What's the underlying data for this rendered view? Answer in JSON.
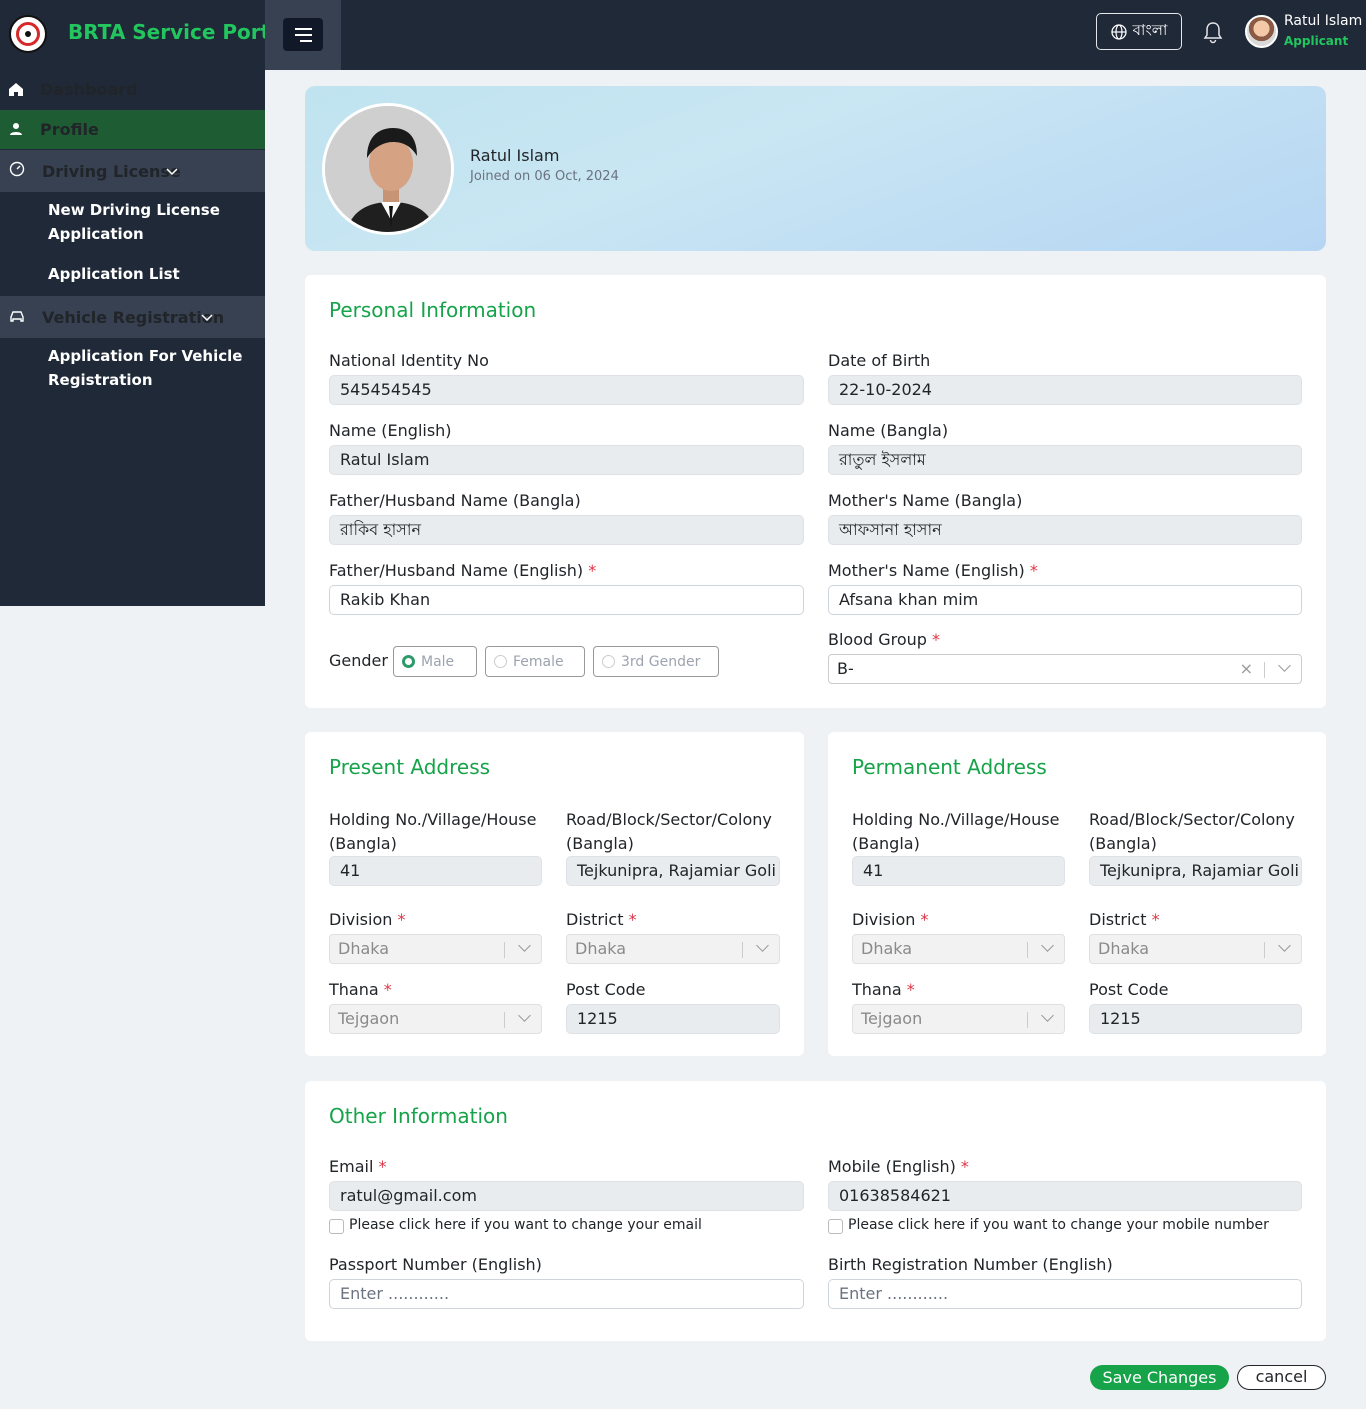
{
  "brand": {
    "title": "BRTA Service Portal"
  },
  "topbar": {
    "language_label": "বাংলা",
    "user_name": "Ratul Islam",
    "user_role": "Applicant"
  },
  "sidebar": {
    "dashboard": "Dashboard",
    "profile": "Profile",
    "driving_license": "Driving License",
    "new_driving_license": "New Driving License Application",
    "application_list": "Application List",
    "vehicle_registration": "Vehicle Registration",
    "vehicle_application": "Application For Vehicle Registration"
  },
  "profile": {
    "name": "Ratul Islam",
    "joined": "Joined on 06 Oct, 2024"
  },
  "personal": {
    "title": "Personal Information",
    "nid_label": "National Identity No",
    "nid": "545454545",
    "dob_label": "Date of Birth",
    "dob": "22-10-2024",
    "name_en_label": "Name (English)",
    "name_en": "Ratul Islam",
    "name_bn_label": "Name (Bangla)",
    "name_bn": "রাতুল ইসলাম",
    "father_bn_label": "Father/Husband Name (Bangla)",
    "father_bn": "রাকিব হাসান",
    "mother_bn_label": "Mother's Name (Bangla)",
    "mother_bn": "আফসানা হাসান",
    "father_en_label": "Father/Husband Name (English)",
    "father_en": "Rakib Khan",
    "mother_en_label": "Mother's Name (English)",
    "mother_en": "Afsana khan mim",
    "gender_label": "Gender",
    "gender_male": "Male",
    "gender_female": "Female",
    "gender_third": "3rd Gender",
    "blood_label": "Blood Group",
    "blood": "B-"
  },
  "present": {
    "title": "Present Address",
    "holding_label": "Holding No./Village/House (Bangla)",
    "holding": "41",
    "road_label": "Road/Block/Sector/Colony (Bangla)",
    "road": "Tejkunipra, Rajamiar Goli",
    "division_label": "Division",
    "division": "Dhaka",
    "district_label": "District",
    "district": "Dhaka",
    "thana_label": "Thana",
    "thana": "Tejgaon",
    "post_label": "Post Code",
    "post": "1215"
  },
  "permanent": {
    "title": "Permanent Address",
    "holding_label": "Holding No./Village/House (Bangla)",
    "holding": "41",
    "road_label": "Road/Block/Sector/Colony (Bangla)",
    "road": "Tejkunipra, Rajamiar Goli",
    "division_label": "Division",
    "division": "Dhaka",
    "district_label": "District",
    "district": "Dhaka",
    "thana_label": "Thana",
    "thana": "Tejgaon",
    "post_label": "Post Code",
    "post": "1215"
  },
  "other": {
    "title": "Other Information",
    "email_label": "Email",
    "email": "ratul@gmail.com",
    "email_change": "Please click here if you want to change your email",
    "mobile_label": "Mobile (English)",
    "mobile": "01638584621",
    "mobile_change": "Please click here if you want to change your mobile number",
    "passport_label": "Passport Number (English)",
    "passport_placeholder": "Enter ............",
    "birth_label": "Birth Registration Number (English)",
    "birth_placeholder": "Enter ............"
  },
  "actions": {
    "save": "Save Changes",
    "cancel": "cancel"
  }
}
